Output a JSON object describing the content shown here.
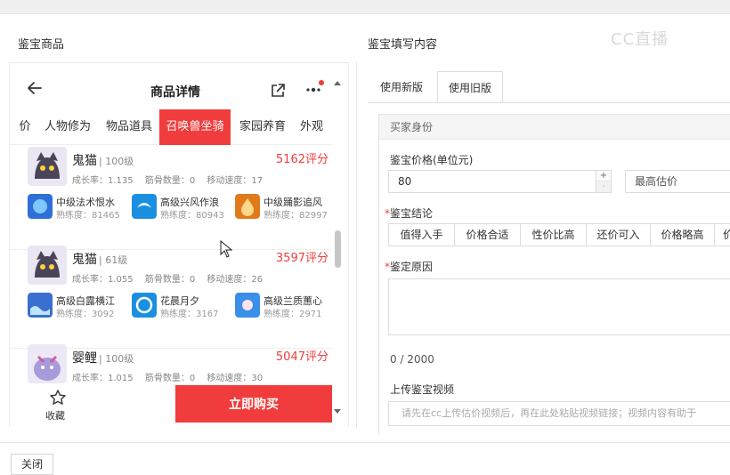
{
  "watermark": "CC直播",
  "left_section_title": "鉴宝商品",
  "right_section_title": "鉴宝填写内容",
  "phone": {
    "title": "商品详情",
    "tabs": [
      "价",
      "人物修为",
      "物品道具",
      "召唤兽坐骑",
      "家园养育",
      "外观"
    ],
    "active_tab": "召唤兽坐骑",
    "pets": [
      {
        "name": "鬼猫",
        "level": "| 100级",
        "score": "5162评分",
        "growth": "成长率：1.135",
        "bones": "筋骨数量：0",
        "speed": "移动速度：17",
        "skills": [
          {
            "name": "中级法术恨水",
            "prof": "熟练度：81465"
          },
          {
            "name": "高级兴风作浪",
            "prof": "熟练度：80943"
          },
          {
            "name": "中级踊影追风",
            "prof": "熟练度：82997"
          }
        ]
      },
      {
        "name": "鬼猫",
        "level": "| 61级",
        "score": "3597评分",
        "growth": "成长率：1.055",
        "bones": "筋骨数量：0",
        "speed": "移动速度：26",
        "skills": [
          {
            "name": "高级白露横江",
            "prof": "熟练度：3092"
          },
          {
            "name": "花晨月夕",
            "prof": "熟练度：3167"
          },
          {
            "name": "高级兰质蕙心",
            "prof": "熟练度：2971"
          }
        ]
      },
      {
        "name": "婴鲤",
        "level": "| 100级",
        "score": "5047评分",
        "growth": "成长率：1.015",
        "bones": "筋骨数量：0",
        "speed": "移动速度：30",
        "skills": []
      }
    ],
    "fav_label": "收藏",
    "buy_label": "立即购买"
  },
  "form": {
    "version_tabs": [
      "使用新版",
      "使用旧版"
    ],
    "active_version": "使用旧版",
    "section_head": "买家身份",
    "price_label": "鉴宝价格(单位元)",
    "price_value": "80",
    "step_up": "+",
    "step_down": "-",
    "estimate_select": "最高估价",
    "conclusion_label": "鉴宝结论",
    "conclusions": [
      "值得入手",
      "价格合适",
      "性价比高",
      "还价可入",
      "价格略高",
      "价"
    ],
    "reason_label": "鉴定原因",
    "counter": "0 / 2000",
    "video_label": "上传鉴宝视频",
    "video_placeholder": "请先在cc上传估价视频后，再在此处粘贴视频链接；视频内容有助于"
  },
  "footer": {
    "close_label": "关闭"
  },
  "colors": {
    "accent": "#f03c3c",
    "border": "#dcdcdc"
  }
}
